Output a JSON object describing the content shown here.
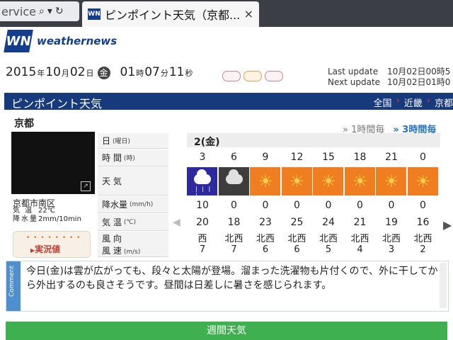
{
  "browser": {
    "address_text": "ervice",
    "tab_favicon": "WN",
    "tab_title": "ピンポイント天気（京都...",
    "close_glyph": "×"
  },
  "header": {
    "logo_mark": "WN",
    "logo_text": "weathernews",
    "date": {
      "year": "2015",
      "year_u": "年",
      "month": "10",
      "month_u": "月",
      "day": "02",
      "day_u": "日",
      "dow": "金",
      "hour": "01",
      "hour_u": "時",
      "minute": "07",
      "minute_u": "分",
      "second": "11",
      "second_u": "秒"
    },
    "pills": [
      "",
      "",
      ""
    ],
    "last_update_label": "Last update",
    "last_update_value": "10月02日00時5",
    "next_update_label": "Next update",
    "next_update_value": "10月02日01時0"
  },
  "section": {
    "title": "ピンポイント天気",
    "crumbs": [
      "全国",
      "近畿",
      "京都"
    ],
    "arrow": "›"
  },
  "location": {
    "city": "京都",
    "toggle_1h": "» 1時間毎",
    "toggle_3h": "» 3時間毎",
    "area": "京都市南区",
    "temp_label": "気 温",
    "temp_value": "22℃",
    "rain_label": "降水量",
    "rain_value": "2mm/10min",
    "jikkyo_label": "実況値"
  },
  "row_labels": {
    "day": "日",
    "day_sub": "(曜日)",
    "time": "時 間",
    "time_sub": "(時)",
    "weather": "天 気",
    "precip": "降水量",
    "precip_sub": "(mm/h)",
    "temp": "気 温",
    "temp_sub": "(℃)",
    "wind_dir": "風 向",
    "wind_speed": "風 速",
    "wind_speed_sub": "(m/s)"
  },
  "forecast": {
    "day_label": "2(金)",
    "hours": [
      "3",
      "6",
      "9",
      "12",
      "15",
      "18",
      "21",
      "0"
    ],
    "weather_icons": [
      "rain-cloud-icon",
      "cloud-icon",
      "sun-icon",
      "sun-icon",
      "sun-icon",
      "sun-icon",
      "sun-icon",
      "sun-icon"
    ],
    "precipitation": [
      "10",
      "0",
      "0",
      "0",
      "0",
      "0",
      "0",
      "0"
    ],
    "temperature": [
      "20",
      "18",
      "23",
      "25",
      "24",
      "21",
      "19",
      "16"
    ],
    "wind_direction": [
      "西",
      "北西",
      "北西",
      "北西",
      "北西",
      "北西",
      "北西",
      "北西"
    ],
    "wind_speed": [
      "7",
      "7",
      "6",
      "6",
      "5",
      "4",
      "3",
      "2"
    ]
  },
  "comment": {
    "tag": "Comment",
    "text": "今日(金)は雲が広がっても、段々と太陽が登場。溜まった洗濯物も片付くので、外に干してから外出するのも良さそうです。昼間は日差しに暑さを感じられます。"
  },
  "weekly_button": "週間天気",
  "colors": {
    "brand_navy": "#143d8c",
    "section_bar": "#163a7c",
    "sunny_bg": "#f07d1f",
    "rain_bg": "#2c2a9e",
    "weekly_green": "#3fb04f"
  }
}
